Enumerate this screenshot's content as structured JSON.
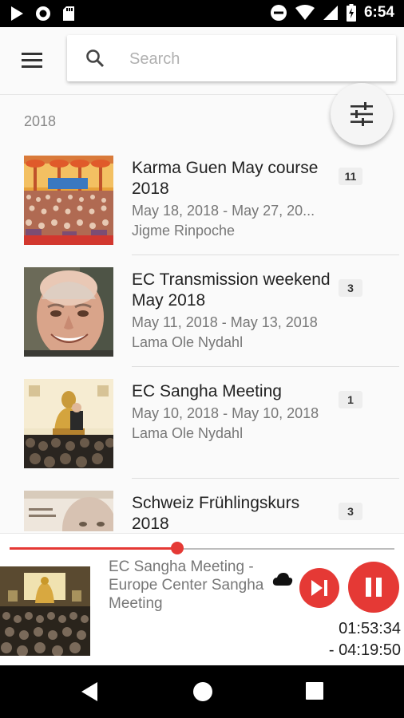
{
  "status_bar": {
    "time": "6:54",
    "icons": [
      "play-icon",
      "record-icon",
      "sd-card-icon",
      "do-not-disturb-icon",
      "wifi-icon",
      "signal-icon",
      "battery-icon"
    ]
  },
  "search": {
    "placeholder": "Search",
    "value": ""
  },
  "section": {
    "year": "2018"
  },
  "events": [
    {
      "title": "Karma Guen May course 2018",
      "dates": "May 18, 2018 - May 27, 20...",
      "teacher": "Jigme Rinpoche",
      "count": "11",
      "thumb": "crowd-hall"
    },
    {
      "title": "EC Transmission weekend May 2018",
      "dates": "May 11, 2018 - May 13, 2018",
      "teacher": "Lama Ole Nydahl",
      "count": "3",
      "thumb": "portrait"
    },
    {
      "title": "EC Sangha Meeting",
      "dates": "May 10, 2018 - May 10, 2018",
      "teacher": "Lama Ole Nydahl",
      "count": "1",
      "thumb": "buddha-stage"
    },
    {
      "title": "Schweiz Frühlingskurs 2018",
      "dates": "",
      "teacher": "",
      "count": "3",
      "thumb": "poster"
    }
  ],
  "player": {
    "title": "EC Sangha Meeting - Europe Center Sangha Meeting",
    "elapsed": "01:53:34",
    "remaining": "- 04:19:50",
    "progress": 0.436
  },
  "colors": {
    "accent": "#e53935",
    "statusbar": "#000000",
    "navbar": "#000000"
  }
}
